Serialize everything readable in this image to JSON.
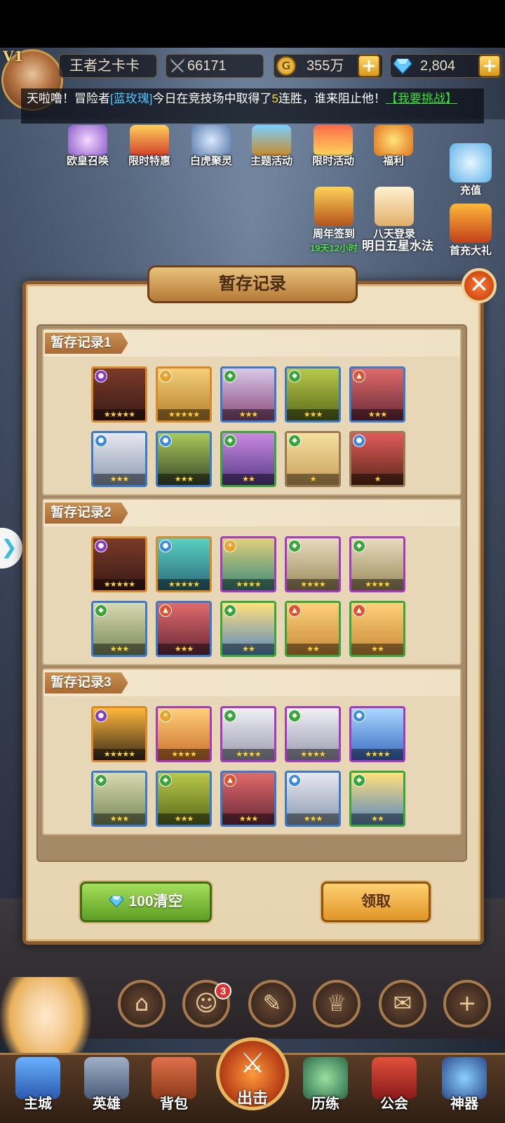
{
  "player": {
    "vip": "V1",
    "name": "王者之卡卡",
    "power": "66171",
    "gold": "355万",
    "gems": "2,804"
  },
  "announcement": {
    "prefix": "天啦噜！冒险者",
    "player": "[蓝玫瑰]",
    "middle": "今日在竞技场中取得了",
    "count": "5",
    "suffix": "连胜，谁来阻止他！",
    "link": "【我要挑战】"
  },
  "activities": [
    {
      "label": "欧皇召唤"
    },
    {
      "label": "限时特惠"
    },
    {
      "label": "白虎聚灵"
    },
    {
      "label": "主题活动"
    },
    {
      "label": "限时活动"
    },
    {
      "label": "福利"
    }
  ],
  "side": {
    "recharge": "充值",
    "first_recharge": "首充大礼"
  },
  "events": {
    "anniversary": {
      "label": "周年签到",
      "timer": "19天12小时"
    },
    "eight_day": {
      "label": "八天登录"
    },
    "tomorrow": "明日五星水法"
  },
  "dialog": {
    "title": "暂存记录",
    "sections": [
      {
        "label": "暂存记录1"
      },
      {
        "label": "暂存记录2"
      },
      {
        "label": "暂存记录3"
      }
    ],
    "clear_button": "100清空",
    "receive_button": "领取"
  },
  "bottom": {
    "badge": "3",
    "nav": [
      "主城",
      "英雄",
      "背包",
      "出击",
      "历练",
      "公会",
      "神器"
    ]
  },
  "colors": {
    "accent_gold": "#d88a2a",
    "frame_purple": "#a53ac0",
    "frame_green": "#3aa63a",
    "frame_blue": "#3a7ac6",
    "clear_green": "#5d9e24",
    "receive_orange": "#e09526"
  }
}
